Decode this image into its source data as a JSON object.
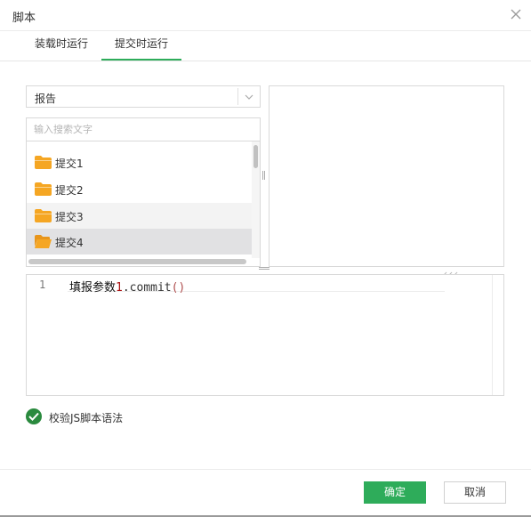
{
  "dialog": {
    "title": "脚本"
  },
  "tabs": [
    {
      "label": "装载时运行",
      "active": false
    },
    {
      "label": "提交时运行",
      "active": true
    }
  ],
  "category_select": {
    "value": "报告"
  },
  "search": {
    "placeholder": "输入搜索文字",
    "value": ""
  },
  "list": {
    "items": [
      {
        "label": "提交1",
        "icon": "folder-icon",
        "state": "normal"
      },
      {
        "label": "提交2",
        "icon": "folder-icon",
        "state": "normal"
      },
      {
        "label": "提交3",
        "icon": "folder-icon",
        "state": "hover"
      },
      {
        "label": "提交4",
        "icon": "folder-open-icon",
        "state": "selected"
      }
    ]
  },
  "editor": {
    "line_number": "1",
    "code": {
      "name": "填报参数",
      "index": "1",
      "call": ".commit",
      "parens": "()"
    }
  },
  "validate": {
    "label": "校验JS脚本语法",
    "checked": true
  },
  "footer": {
    "ok_label": "确定",
    "cancel_label": "取消"
  },
  "colors": {
    "accent": "#2eac5a",
    "folder": "#f5a623",
    "check": "#2a8a3e"
  }
}
